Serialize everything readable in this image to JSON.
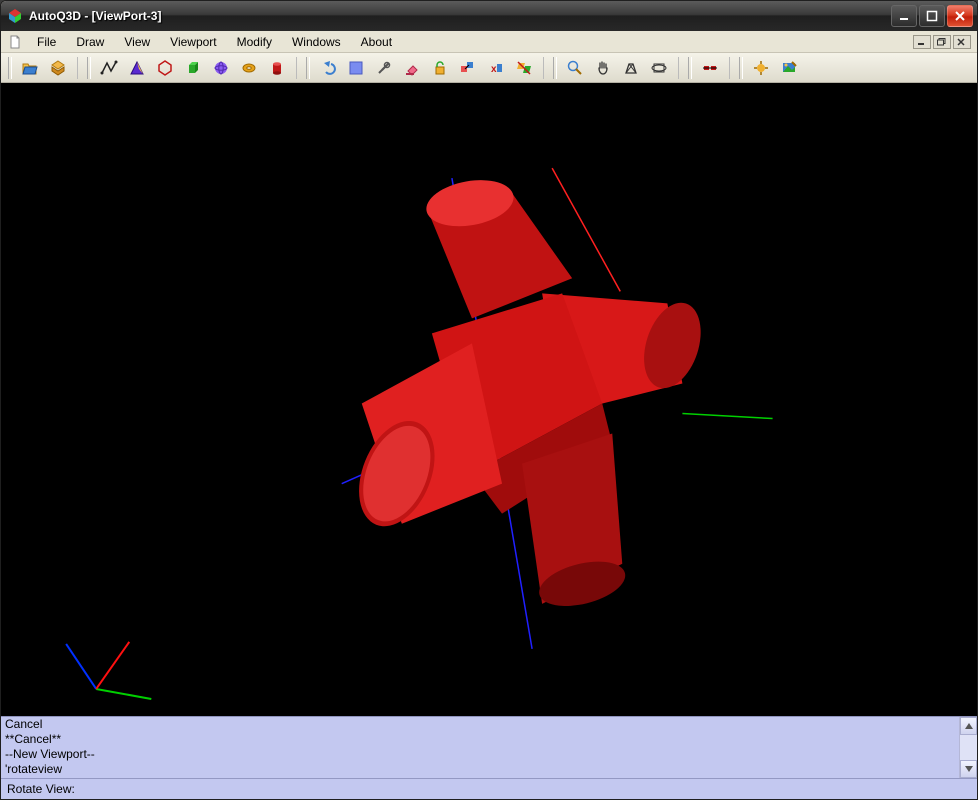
{
  "window": {
    "title": "AutoQ3D - [ViewPort-3]"
  },
  "menubar": {
    "items": [
      "File",
      "Draw",
      "View",
      "Viewport",
      "Modify",
      "Windows",
      "About"
    ]
  },
  "toolbar": {
    "groups": [
      [
        "open-icon",
        "save-icon"
      ],
      [
        "polyline-icon",
        "triangle-icon",
        "hexagon-icon",
        "cube-icon",
        "sphere-icon",
        "torus-icon",
        "cylinder-icon"
      ],
      [
        "undo-icon",
        "fill-icon",
        "tools-icon",
        "eraser-icon",
        "unlock-icon",
        "group-icon",
        "delete-vertex-icon",
        "ungroup-icon"
      ],
      [
        "zoom-icon",
        "pan-icon",
        "perspective-icon",
        "orbit-icon"
      ],
      [
        "align-icon"
      ],
      [
        "settings-icon",
        "render-icon"
      ]
    ]
  },
  "viewport": {
    "object_color": "#e01818",
    "axes": {
      "origin_x": "#00c000",
      "origin_y": "#0000ff",
      "origin_z": "#ff0000"
    }
  },
  "command": {
    "log_lines": [
      "  Cancel",
      "**Cancel**",
      "--New Viewport--",
      "'rotateview"
    ],
    "prompt_label": "Rotate View:",
    "input_value": ""
  },
  "colors": {
    "toolbar_bg": "#e6e3d5",
    "command_bg": "#c3c8f0"
  }
}
